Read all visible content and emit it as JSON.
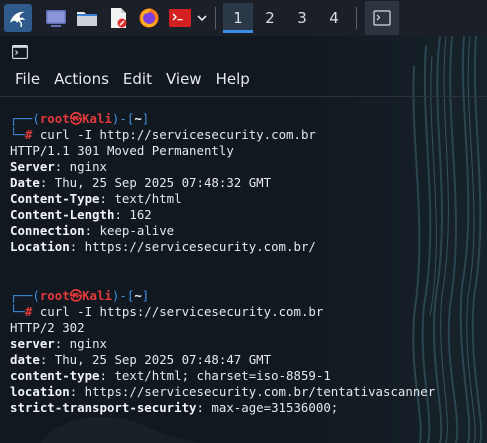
{
  "taskbar": {
    "workspaces": [
      "1",
      "2",
      "3",
      "4"
    ],
    "current_workspace": "1",
    "colors": {
      "active_bg": "#2f5b8c",
      "workspace_highlight": "#3b8ee8"
    },
    "launchers": [
      "kali-dragon-icon",
      "desktop-icon",
      "file-manager-icon",
      "text-editor-icon",
      "firefox-icon",
      "terminal-launcher-icon"
    ]
  },
  "terminal": {
    "menu": [
      "File",
      "Actions",
      "Edit",
      "View",
      "Help"
    ],
    "session1": {
      "prompt": {
        "left": "┌──(",
        "user": "root",
        "at": "㉿",
        "host": "Kali",
        "mid": ")-[",
        "dir": "~",
        "close": "]",
        "corner": "└─",
        "hash": "#"
      },
      "command": " curl -I http://servicesecurity.com.br",
      "status": "HTTP/1.1 301 Moved Permanently",
      "headers": [
        {
          "name": "Server",
          "value": ": nginx"
        },
        {
          "name": "Date",
          "value": ": Thu, 25 Sep 2025 07:48:32 GMT"
        },
        {
          "name": "Content-Type",
          "value": ": text/html"
        },
        {
          "name": "Content-Length",
          "value": ": 162"
        },
        {
          "name": "Connection",
          "value": ": keep-alive"
        },
        {
          "name": "Location",
          "value": ": https://servicesecurity.com.br/"
        }
      ]
    },
    "session2": {
      "prompt": {
        "left": "┌──(",
        "user": "root",
        "at": "㉿",
        "host": "Kali",
        "mid": ")-[",
        "dir": "~",
        "close": "]",
        "corner": "└─",
        "hash": "#"
      },
      "command": " curl -I https://servicesecurity.com.br",
      "status": "HTTP/2 302",
      "headers": [
        {
          "name": "server",
          "value": ": nginx"
        },
        {
          "name": "date",
          "value": ": Thu, 25 Sep 2025 07:48:47 GMT"
        },
        {
          "name": "content-type",
          "value": ": text/html; charset=iso-8859-1"
        },
        {
          "name": "location",
          "value": ": https://servicesecurity.com.br/tentativascanner"
        },
        {
          "name": "strict-transport-security",
          "value": ": max-age=31536000;"
        }
      ]
    }
  }
}
